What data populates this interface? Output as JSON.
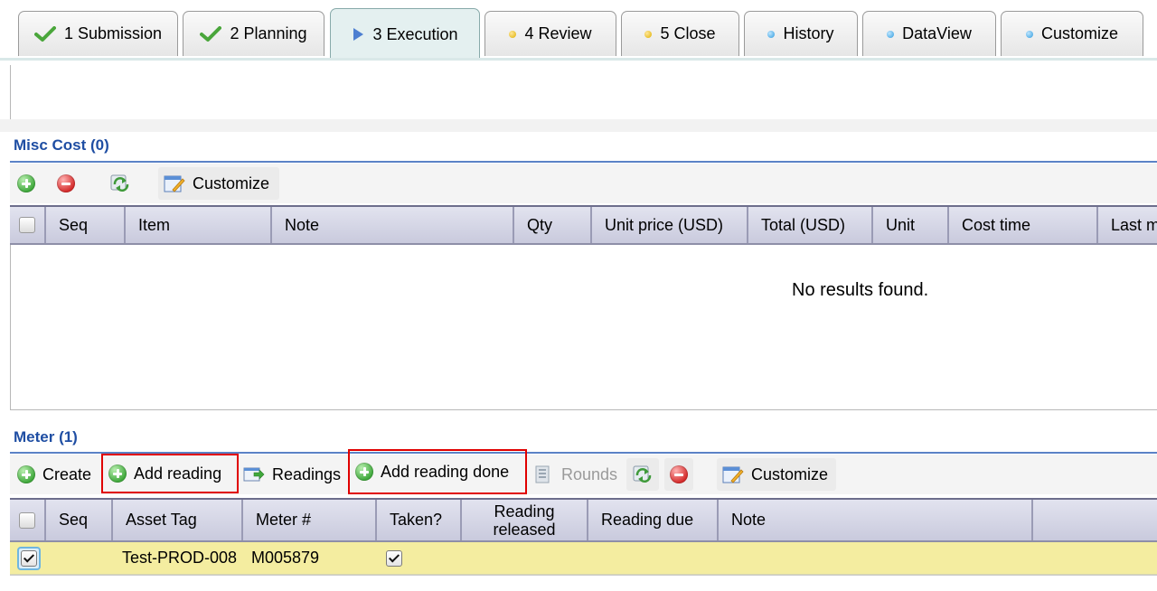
{
  "tabs": [
    {
      "label": "1 Submission",
      "icon": "check-icon",
      "state": "done"
    },
    {
      "label": "2 Planning",
      "icon": "check-icon",
      "state": "done"
    },
    {
      "label": "3 Execution",
      "icon": "play-icon",
      "state": "active"
    },
    {
      "label": "4 Review",
      "icon": "yellow-dot-icon",
      "state": "pending"
    },
    {
      "label": "5 Close",
      "icon": "yellow-dot-icon",
      "state": "pending"
    },
    {
      "label": "History",
      "icon": "blue-dot-icon",
      "state": "info"
    },
    {
      "label": "DataView",
      "icon": "blue-dot-icon",
      "state": "info"
    },
    {
      "label": "Customize",
      "icon": "blue-dot-icon",
      "state": "info"
    }
  ],
  "misc_cost": {
    "title": "Misc Cost (0)",
    "toolbar": {
      "customize_label": "Customize"
    },
    "columns": [
      "Seq",
      "Item",
      "Note",
      "Qty",
      "Unit price (USD)",
      "Total (USD)",
      "Unit",
      "Cost time",
      "Last m"
    ],
    "empty_message": "No results found."
  },
  "meter": {
    "title": "Meter (1)",
    "toolbar": {
      "create_label": "Create",
      "add_reading_label": "Add reading",
      "readings_label": "Readings",
      "add_reading_done_label": "Add reading done",
      "rounds_label": "Rounds",
      "customize_label": "Customize"
    },
    "columns": [
      "Seq",
      "Asset Tag",
      "Meter #",
      "Taken?",
      "Reading released",
      "Reading due",
      "Note"
    ],
    "rows": [
      {
        "seq": "",
        "asset_tag": "Test-PROD-008",
        "meter_no": "M005879",
        "taken": true,
        "reading_released": "",
        "reading_due": "",
        "note": "",
        "selected": true
      }
    ]
  },
  "colors": {
    "section_title": "#1f4ea3",
    "selected_row": "#f4eda0",
    "highlight_box": "#e00000",
    "header_bg": "#c9cadd"
  }
}
